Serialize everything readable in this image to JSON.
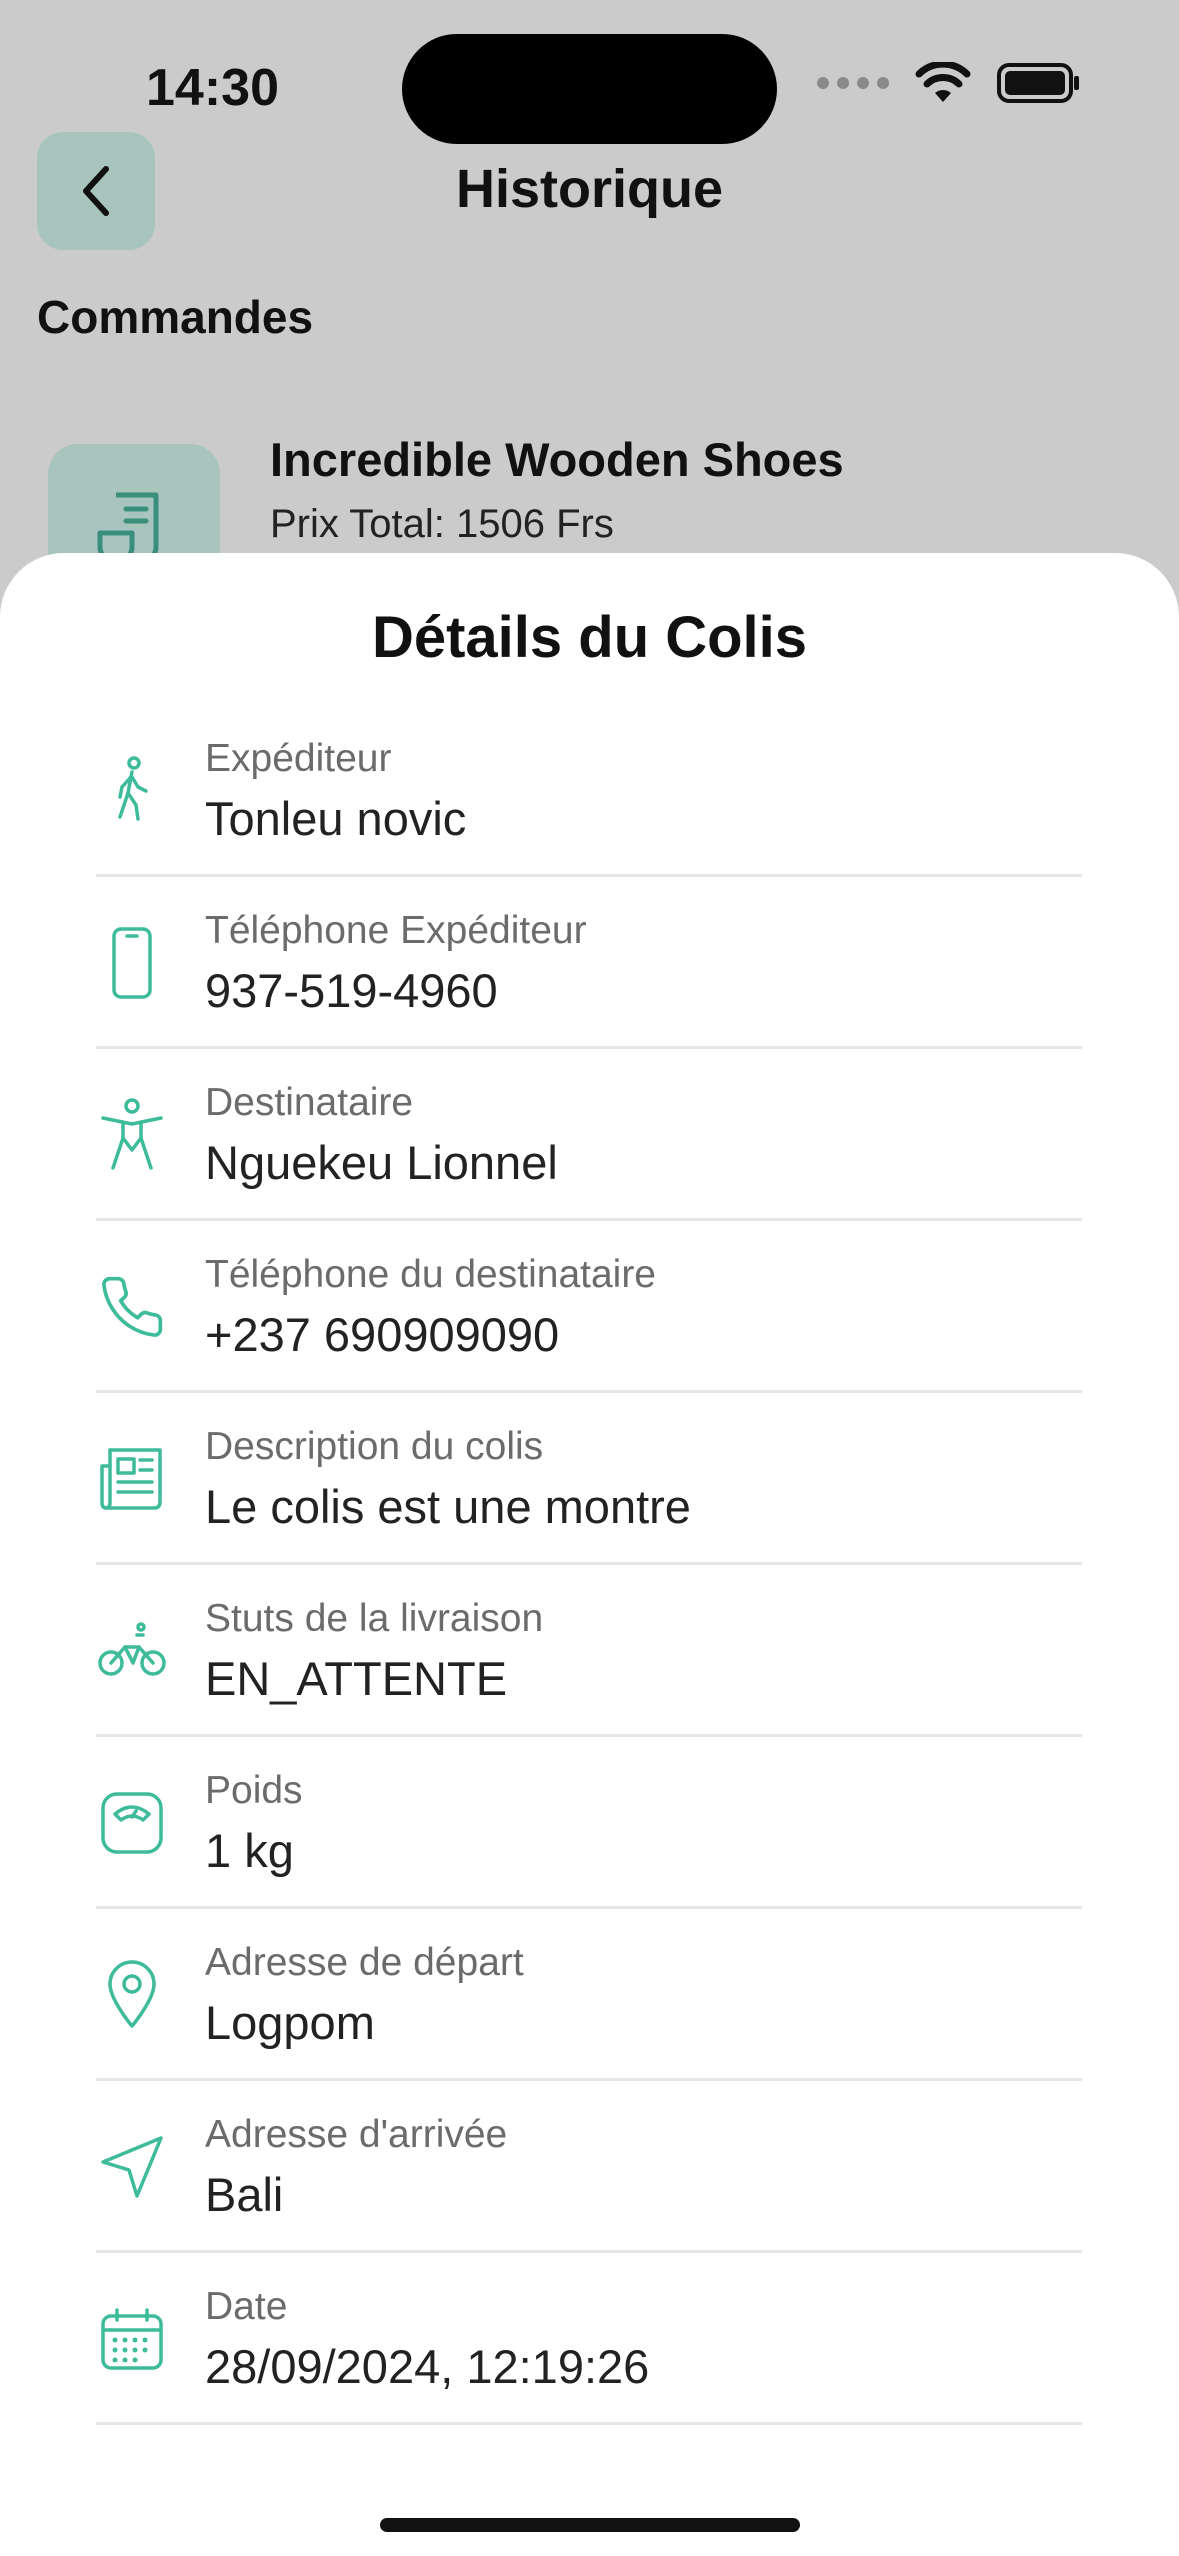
{
  "status_bar": {
    "time": "14:30"
  },
  "header": {
    "back_label": "Retour",
    "title": "Historique"
  },
  "section": {
    "title": "Commandes"
  },
  "order": {
    "name": "Incredible Wooden Shoes",
    "price": "Prix Total: 1506 Frs"
  },
  "sheet": {
    "title": "Détails du Colis",
    "rows": [
      {
        "icon": "walking-person-icon",
        "label": "Expéditeur",
        "value": "Tonleu novic"
      },
      {
        "icon": "smartphone-icon",
        "label": "Téléphone Expéditeur",
        "value": "937-519-4960"
      },
      {
        "icon": "accessibility-person-icon",
        "label": "Destinataire",
        "value": "Nguekeu Lionnel"
      },
      {
        "icon": "phone-icon",
        "label": "Téléphone du destinataire",
        "value": "+237 690909090"
      },
      {
        "icon": "newspaper-icon",
        "label": "Description du colis",
        "value": "Le colis est une montre"
      },
      {
        "icon": "bicycle-icon",
        "label": "Stuts de la livraison",
        "value": "EN_ATTENTE"
      },
      {
        "icon": "scale-icon",
        "label": "Poids",
        "value": "1 kg"
      },
      {
        "icon": "map-pin-icon",
        "label": "Adresse de départ",
        "value": "Logpom"
      },
      {
        "icon": "navigation-arrow-icon",
        "label": "Adresse d'arrivée",
        "value": "Bali"
      },
      {
        "icon": "calendar-icon",
        "label": "Date",
        "value": "28/09/2024, 12:19:26"
      }
    ]
  },
  "colors": {
    "accent": "#3dbb9b",
    "overlay": "#cbcbcb",
    "icon_bg": "#a7c4bd"
  }
}
